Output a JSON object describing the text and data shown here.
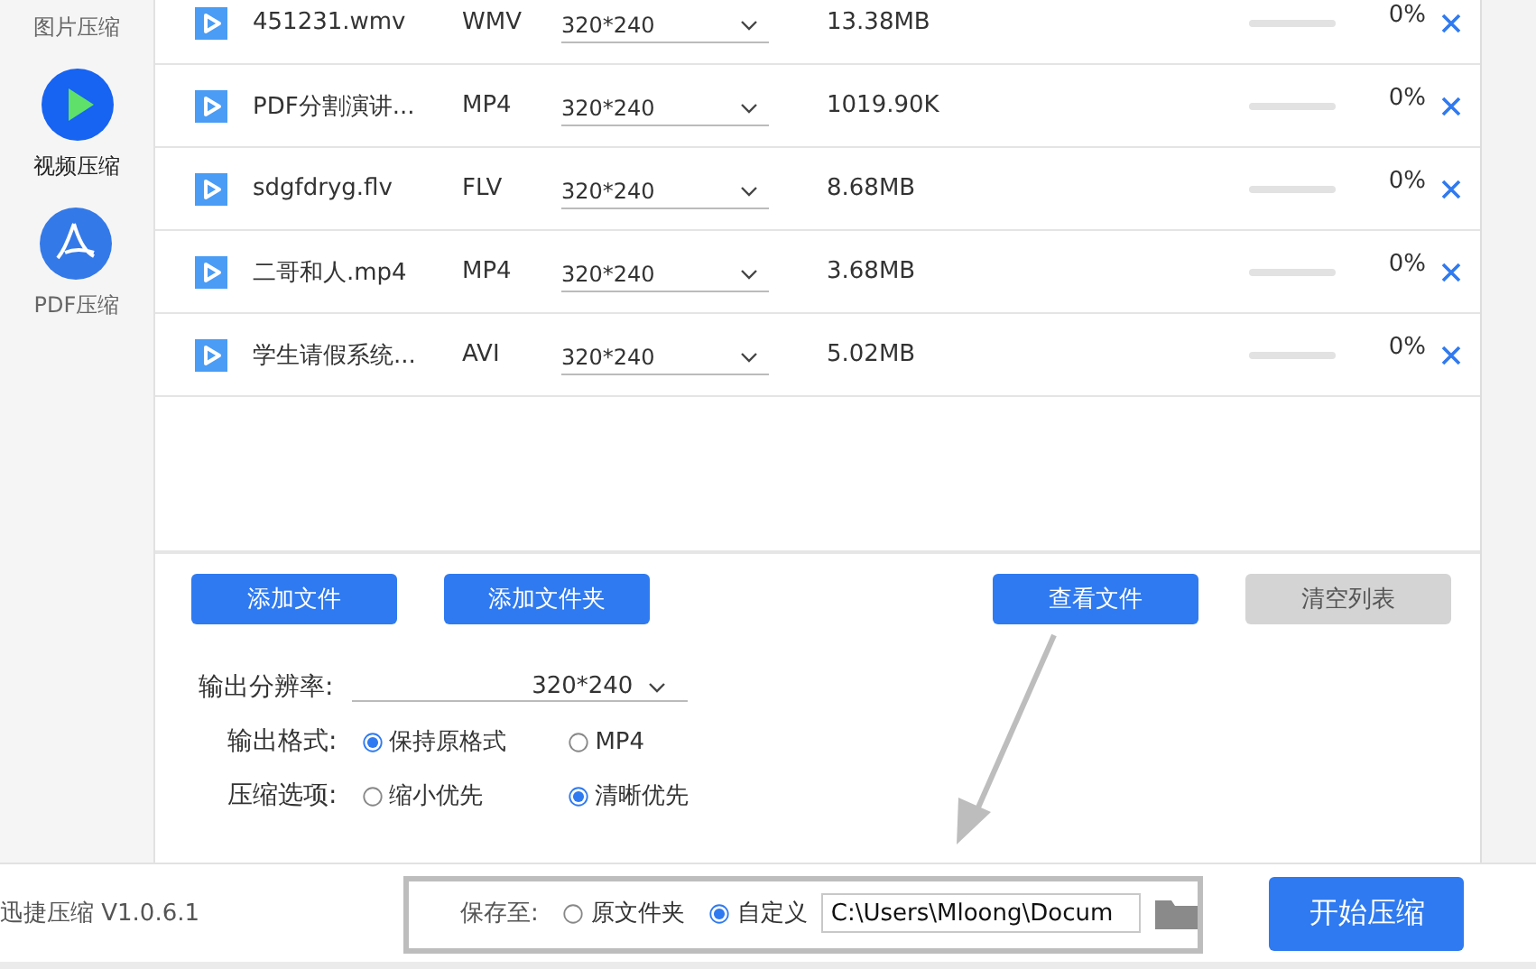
{
  "sidebar": {
    "items": [
      {
        "label": "图片压缩",
        "kind": "image",
        "selected": false
      },
      {
        "label": "视频压缩",
        "kind": "video",
        "selected": true
      },
      {
        "label": "PDF压缩",
        "kind": "pdf",
        "selected": false
      }
    ]
  },
  "files": [
    {
      "name": "451231.wmv",
      "format": "WMV",
      "resolution": "320*240",
      "size": "13.38MB",
      "level": 0,
      "percent": "0%"
    },
    {
      "name": "PDF分割演讲...",
      "format": "MP4",
      "resolution": "320*240",
      "size": "1019.90K",
      "level": 0,
      "percent": "0%"
    },
    {
      "name": "sdgfdryg.flv",
      "format": "FLV",
      "resolution": "320*240",
      "size": "8.68MB",
      "level": 0,
      "percent": "0%"
    },
    {
      "name": "二哥和人.mp4",
      "format": "MP4",
      "resolution": "320*240",
      "size": "3.68MB",
      "level": 0,
      "percent": "0%"
    },
    {
      "name": "学生请假系统...",
      "format": "AVI",
      "resolution": "320*240",
      "size": "5.02MB",
      "level": 0,
      "percent": "0%"
    }
  ],
  "buttons": [
    {
      "label": "添加文件",
      "disabled": false
    },
    {
      "label": "添加文件夹",
      "disabled": false
    },
    {
      "label": "查看文件",
      "disabled": false
    },
    {
      "label": "清空列表",
      "disabled": true
    }
  ],
  "settings": {
    "resolution": {
      "label": "输出分辨率:",
      "value": "320*240"
    },
    "format": {
      "label": "输出格式:",
      "options": [
        {
          "label": "保持原格式",
          "selected": true
        },
        {
          "label": "MP4",
          "selected": false
        }
      ]
    },
    "compression": {
      "label": "压缩选项:",
      "options": [
        {
          "label": "缩小优先",
          "selected": false
        },
        {
          "label": "清晰优先",
          "selected": true
        }
      ]
    }
  },
  "status_bar": {
    "version": "迅捷压缩 V1.0.6.1",
    "save_to": {
      "label": "保存至:",
      "options": [
        {
          "label": "原文件夹",
          "selected": false
        },
        {
          "label": "自定义",
          "selected": true
        }
      ],
      "path": "C:\\Users\\Mloong\\Docum"
    },
    "start_button": "开始压缩"
  }
}
